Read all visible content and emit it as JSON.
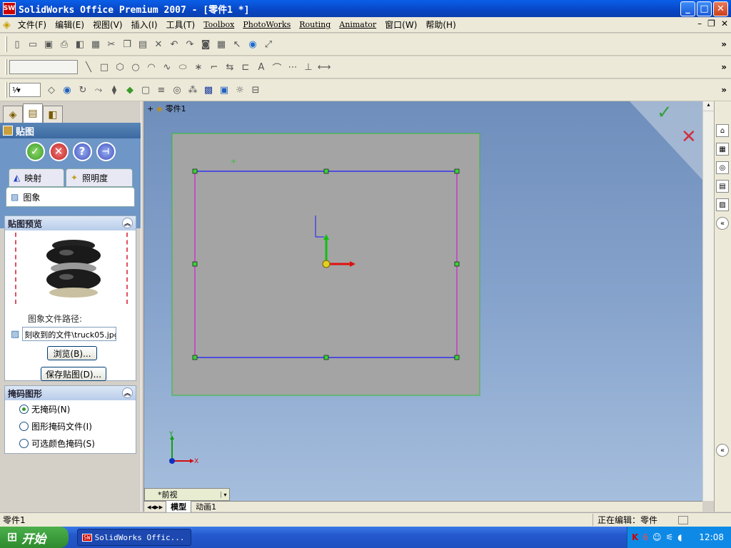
{
  "window": {
    "title": "SolidWorks Office Premium 2007 - [零件1 *]",
    "app_badge": "SW"
  },
  "menu": [
    "文件(F)",
    "编辑(E)",
    "视图(V)",
    "插入(I)",
    "工具(T)",
    "Toolbox",
    "PhotoWorks",
    "Routing",
    "Animator",
    "窗口(W)",
    "帮助(H)"
  ],
  "property_manager": {
    "title": "贴图",
    "tabs": {
      "mapping": "映射",
      "lighting": "照明度",
      "image": "图象"
    },
    "preview_section": {
      "title": "贴图预览",
      "path_label": "图象文件路径:",
      "path_value": "刻收到的文件\\truck05.jpg",
      "browse": "浏览(B)...",
      "save": "保存贴图(D)..."
    },
    "mask_section": {
      "title": "掩码图形",
      "options": [
        "无掩码(N)",
        "图形掩码文件(I)",
        "可选颜色掩码(S)"
      ],
      "selected": 0
    }
  },
  "viewport": {
    "tree_item": "零件1",
    "view_name": "*前视",
    "triad_y": "Y",
    "triad_x": "X",
    "bottom_tabs": [
      "模型",
      "动画1"
    ]
  },
  "status": {
    "left": "零件1",
    "editing": "正在编辑：零件"
  },
  "taskbar": {
    "start": "开始",
    "task": "SolidWorks Offic...",
    "time": "12:08"
  },
  "colors": {
    "titlebar": "#0a4fd8",
    "viewport_bg": "#86a3cc",
    "sketch_blue": "#1a1aff",
    "sketch_magenta": "#d020d0",
    "plane_gray": "#a4a4a4"
  }
}
